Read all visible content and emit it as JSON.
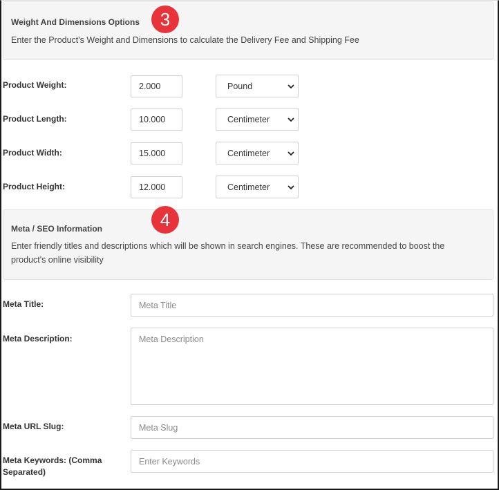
{
  "weight_section": {
    "title": "Weight And Dimensions Options",
    "description": "Enter the Product's Weight and Dimensions to calculate the Delivery Fee and Shipping Fee",
    "step_badge": "3"
  },
  "dimensions": [
    {
      "label": "Product Weight:",
      "value": "2.000",
      "unit": "Pound"
    },
    {
      "label": "Product Length:",
      "value": "10.000",
      "unit": "Centimeter"
    },
    {
      "label": "Product Width:",
      "value": "15.000",
      "unit": "Centimeter"
    },
    {
      "label": "Product Height:",
      "value": "12.000",
      "unit": "Centimeter"
    }
  ],
  "seo_section": {
    "title": "Meta / SEO Information",
    "description_line1": "Enter friendly titles and descriptions which will be shown in search engines. These are recommended to boost the",
    "description_line2": "product's online visibility",
    "step_badge": "4"
  },
  "meta_fields": {
    "title": {
      "label": "Meta Title:",
      "placeholder": "Meta Title"
    },
    "description": {
      "label": "Meta Description:",
      "placeholder": "Meta Description"
    },
    "slug": {
      "label": "Meta URL Slug:",
      "placeholder": "Meta Slug"
    },
    "keywords": {
      "label_line1": "Meta Keywords: (Comma",
      "label_line2": "Separated)",
      "placeholder": "Enter Keywords"
    }
  },
  "colors": {
    "badge": "#e8333a",
    "panel_bg": "#f5f5f5"
  }
}
